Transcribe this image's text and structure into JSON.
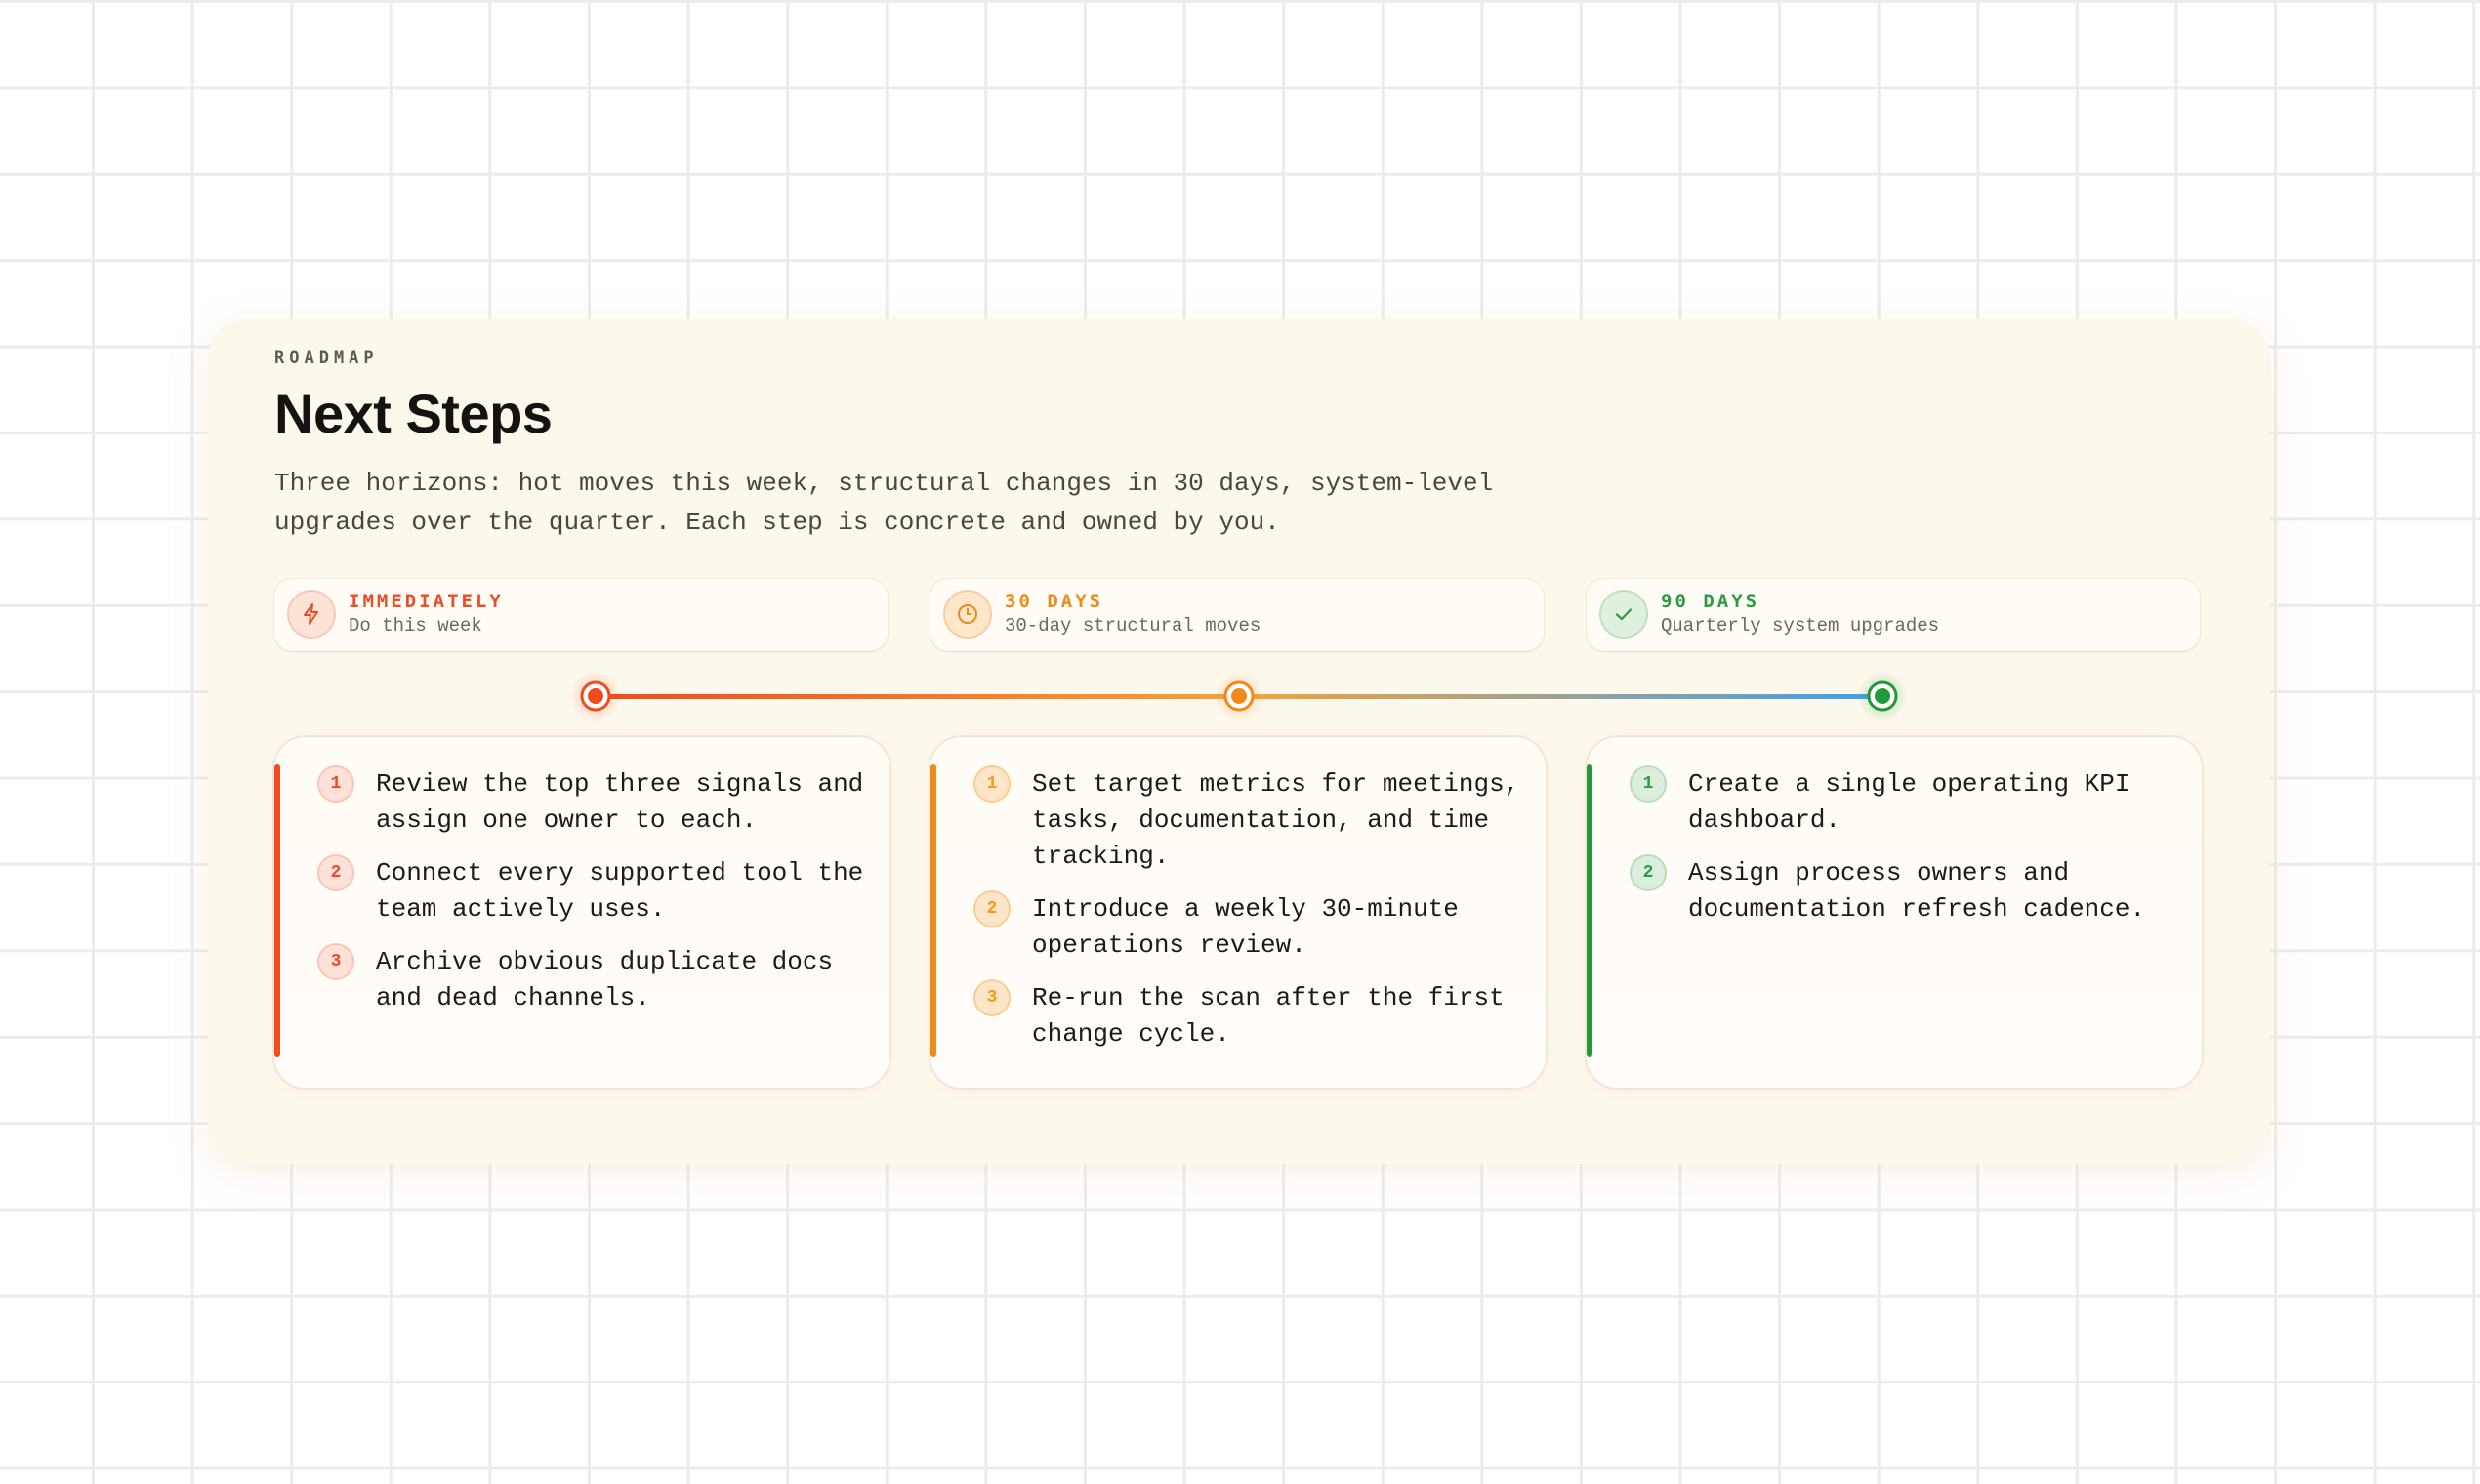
{
  "header": {
    "eyebrow": "ROADMAP",
    "title": "Next Steps",
    "subtitle": "Three horizons: hot moves this week, structural changes in 30 days, system-level upgrades over the quarter. Each step is concrete and owned by you."
  },
  "colors": {
    "immediately": "#f04a1e",
    "days30": "#f08a1a",
    "days90": "#1e9a3a",
    "track_end": "#3da1f2"
  },
  "horizons": [
    {
      "label": "IMMEDIATELY",
      "sub": "Do this week",
      "icon": "lightning-icon"
    },
    {
      "label": "30 DAYS",
      "sub": "30-day structural moves",
      "icon": "clock-icon"
    },
    {
      "label": "90 DAYS",
      "sub": "Quarterly system upgrades",
      "icon": "check-icon"
    }
  ],
  "columns": [
    {
      "steps": [
        {
          "num": "1",
          "text": "Review the top three signals and assign one owner to each."
        },
        {
          "num": "2",
          "text": "Connect every supported tool the team actively uses."
        },
        {
          "num": "3",
          "text": "Archive obvious duplicate docs and dead channels."
        }
      ]
    },
    {
      "steps": [
        {
          "num": "1",
          "text": "Set target metrics for meetings, tasks, documentation, and time tracking."
        },
        {
          "num": "2",
          "text": "Introduce a weekly 30-minute operations review."
        },
        {
          "num": "3",
          "text": "Re-run the scan after the first change cycle."
        }
      ]
    },
    {
      "steps": [
        {
          "num": "1",
          "text": "Create a single operating KPI dashboard."
        },
        {
          "num": "2",
          "text": "Assign process owners and documentation refresh cadence."
        }
      ]
    }
  ]
}
